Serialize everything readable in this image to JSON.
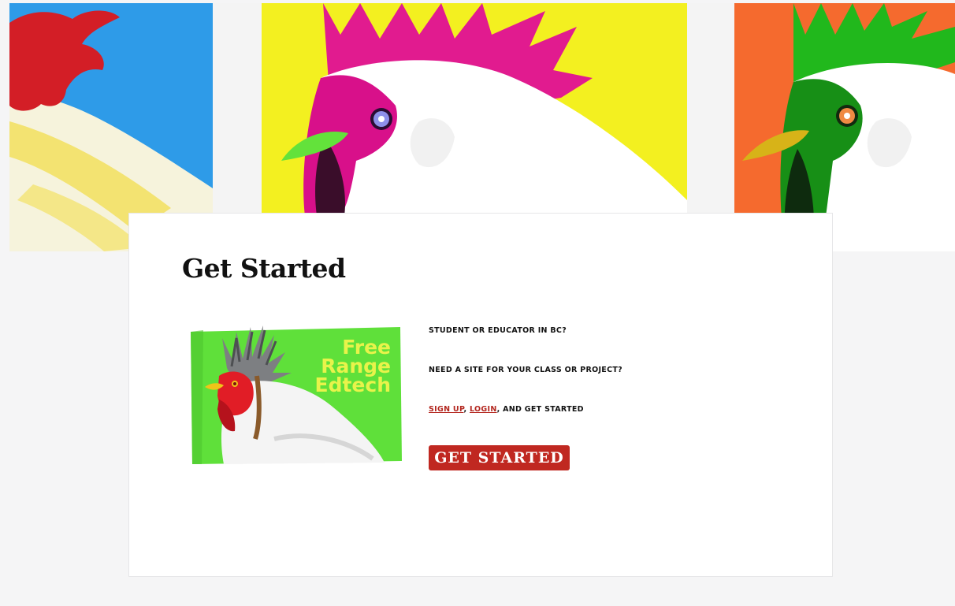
{
  "card": {
    "title": "Get Started",
    "lines": {
      "q1": "STUDENT OR EDUCATOR IN BC?",
      "q2": "NEED A SITE FOR YOUR CLASS OR PROJECT?"
    },
    "signup": {
      "signup_link": "SIGN UP",
      "sep": ", ",
      "login_link": "LOGIN",
      "rest": ", AND GET STARTED"
    },
    "cta_label": "GET STARTED"
  },
  "logo": {
    "text_lines": [
      "Free",
      "Range",
      "Edtech"
    ]
  },
  "colors": {
    "accent": "#c02821",
    "link": "#b3261e",
    "panel_blue": "#2e9be8",
    "panel_yellow": "#f3f020",
    "panel_orange": "#f56a2e",
    "logo_green": "#5fe03a",
    "logo_text": "#e8f34a"
  },
  "icons": {
    "hero": "three-chickens-illustration",
    "logo": "free-range-edtech-chicken-logo"
  }
}
